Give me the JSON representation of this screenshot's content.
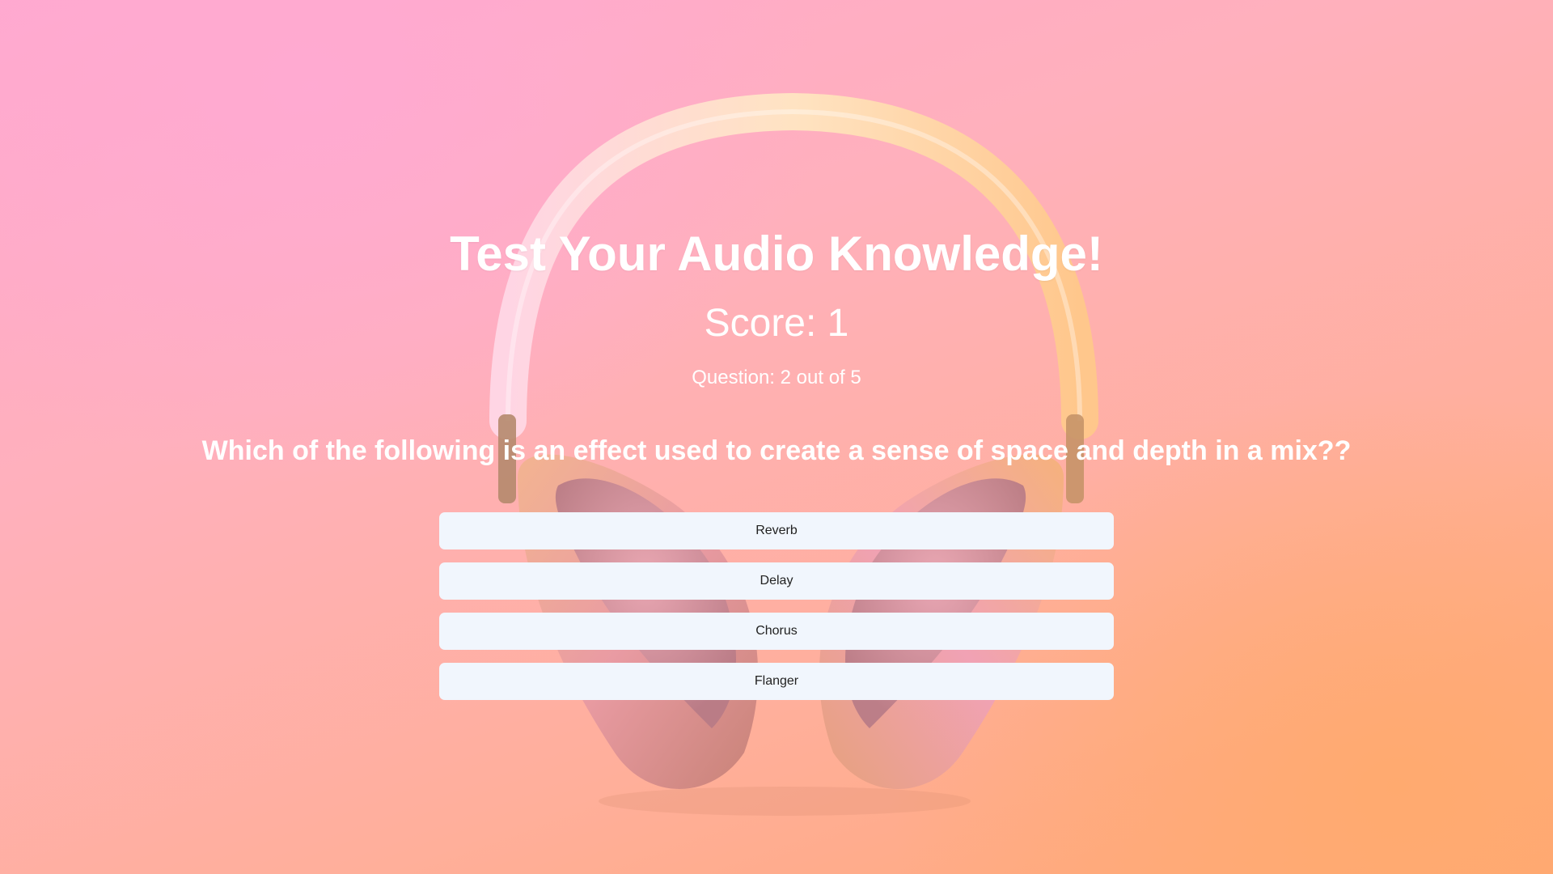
{
  "quiz": {
    "title": "Test Your Audio Knowledge!",
    "score_text": "Score: 1",
    "progress_text": "Question: 2 out of 5",
    "question": "Which of the following is an effect used to create a sense of space and depth in a mix??",
    "answers": [
      {
        "label": "Reverb"
      },
      {
        "label": "Delay"
      },
      {
        "label": "Chorus"
      },
      {
        "label": "Flanger"
      }
    ]
  },
  "background": {
    "subject": "headphones-image"
  },
  "colors": {
    "answer_button_bg": "#f1f6fd",
    "answer_button_text": "#222222",
    "heading_text": "#ffffff"
  }
}
